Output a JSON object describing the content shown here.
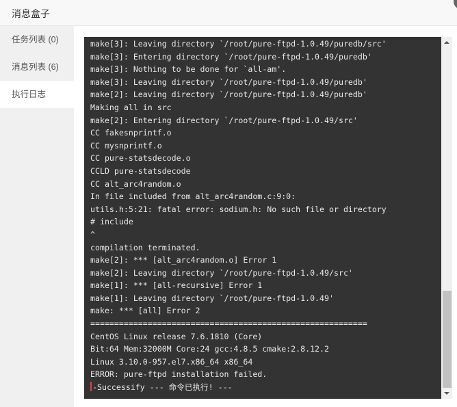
{
  "header": {
    "title": "消息盒子"
  },
  "sidebar": {
    "items": [
      {
        "label": "任务列表 (0)",
        "active": false
      },
      {
        "label": "消息列表 (6)",
        "active": false
      },
      {
        "label": "执行日志",
        "active": true
      }
    ]
  },
  "console": {
    "lines": [
      "make[3]: Leaving directory `/root/pure-ftpd-1.0.49/puredb/src'",
      "make[3]: Entering directory `/root/pure-ftpd-1.0.49/puredb'",
      "make[3]: Nothing to be done for `all-am'.",
      "make[3]: Leaving directory `/root/pure-ftpd-1.0.49/puredb'",
      "make[2]: Leaving directory `/root/pure-ftpd-1.0.49/puredb'",
      "Making all in src",
      "make[2]: Entering directory `/root/pure-ftpd-1.0.49/src'",
      "CC fakesnprintf.o",
      "CC mysnprintf.o",
      "CC pure-statsdecode.o",
      "CCLD pure-statsdecode",
      "CC alt_arc4random.o",
      "In file included from alt_arc4random.c:9:0:",
      "utils.h:5:21: fatal error: sodium.h: No such file or directory",
      "# include",
      "^",
      "compilation terminated.",
      "make[2]: *** [alt_arc4random.o] Error 1",
      "make[2]: Leaving directory `/root/pure-ftpd-1.0.49/src'",
      "make[1]: *** [all-recursive] Error 1",
      "make[1]: Leaving directory `/root/pure-ftpd-1.0.49'",
      "make: *** [all] Error 2",
      "==========================================================",
      "CentOS Linux release 7.6.1810 (Core)",
      "Bit:64 Mem:32000M Core:24 gcc:4.8.5 cmake:2.8.12.2",
      "Linux 3.10.0-957.el7.x86_64 x86_64",
      "ERROR: pure-ftpd installation failed.",
      "-Successify --- 命令已执行! ---"
    ]
  },
  "colors": {
    "console_bg": "#333333",
    "console_text": "#e8e8e8",
    "sidebar_bg": "#f0f0f0",
    "header_bg": "#f8f8f8"
  }
}
